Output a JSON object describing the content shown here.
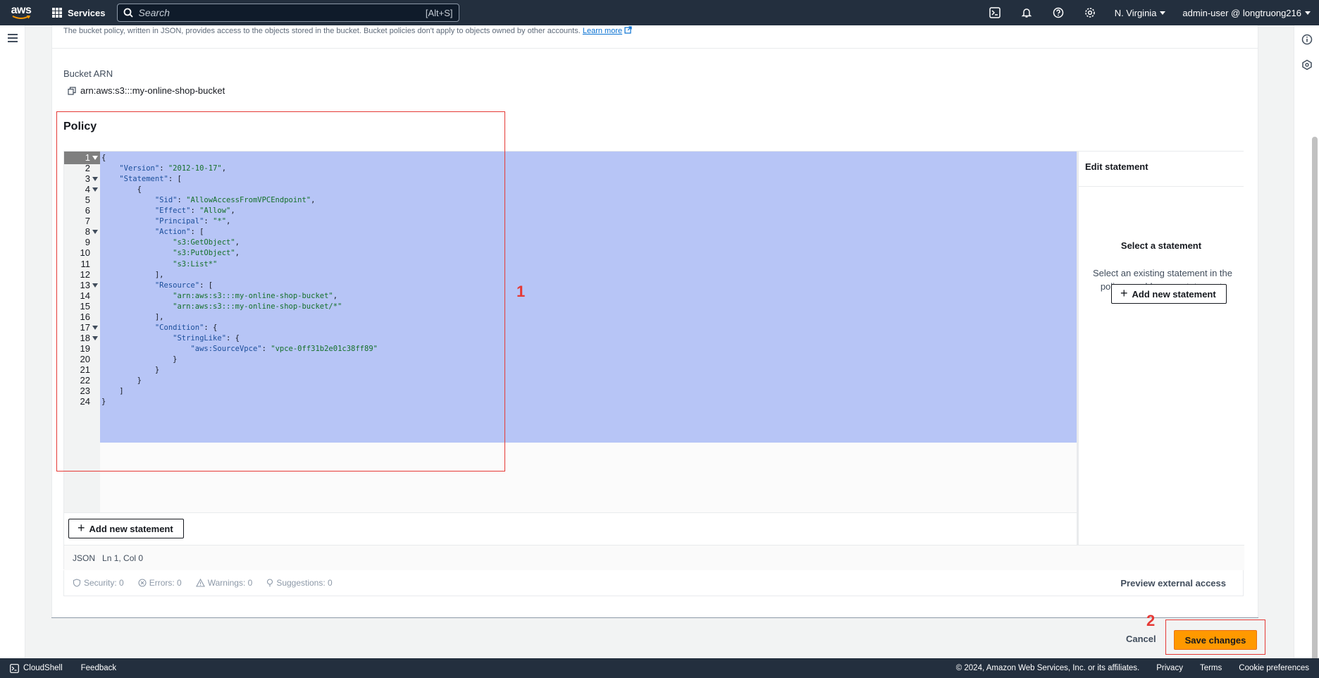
{
  "topnav": {
    "logo_text": "aws",
    "services_label": "Services",
    "search_placeholder": "Search",
    "search_shortcut": "[Alt+S]",
    "region": "N. Virginia",
    "account": "admin-user @ longtruong216"
  },
  "page": {
    "description": "The bucket policy, written in JSON, provides access to the objects stored in the bucket. Bucket policies don't apply to objects owned by other accounts.",
    "learn_more": "Learn more",
    "arn_label": "Bucket ARN",
    "arn_value": "arn:aws:s3:::my-online-shop-bucket",
    "policy_title": "Policy"
  },
  "editor": {
    "lines": [
      "{",
      "    \"Version\": \"2012-10-17\",",
      "    \"Statement\": [",
      "        {",
      "            \"Sid\": \"AllowAccessFromVPCEndpoint\",",
      "            \"Effect\": \"Allow\",",
      "            \"Principal\": \"*\",",
      "            \"Action\": [",
      "                \"s3:GetObject\",",
      "                \"s3:PutObject\",",
      "                \"s3:List*\"",
      "            ],",
      "            \"Resource\": [",
      "                \"arn:aws:s3:::my-online-shop-bucket\",",
      "                \"arn:aws:s3:::my-online-shop-bucket/*\"",
      "            ],",
      "            \"Condition\": {",
      "                \"StringLike\": {",
      "                    \"aws:SourceVpce\": \"vpce-0ff31b2e01c38ff89\"",
      "                }",
      "            }",
      "        }",
      "    ]",
      "}"
    ],
    "fold_lines": [
      1,
      3,
      4,
      8,
      13,
      17,
      18
    ],
    "add_statement_label": "Add new statement",
    "status_mode": "JSON",
    "status_position": "Ln 1, Col 0"
  },
  "statement_panel": {
    "header": "Edit statement",
    "title": "Select a statement",
    "description": "Select an existing statement in the policy or add a new statement.",
    "add_button": "Add new statement"
  },
  "validation": {
    "security": "Security: 0",
    "errors": "Errors: 0",
    "warnings": "Warnings: 0",
    "suggestions": "Suggestions: 0",
    "preview": "Preview external access"
  },
  "actions": {
    "cancel": "Cancel",
    "save": "Save changes"
  },
  "annotations": {
    "label_1": "1",
    "label_2": "2",
    "color": "#e53935"
  },
  "footer": {
    "cloudshell": "CloudShell",
    "feedback": "Feedback",
    "copyright": "© 2024, Amazon Web Services, Inc. or its affiliates.",
    "privacy": "Privacy",
    "terms": "Terms",
    "cookies": "Cookie preferences"
  },
  "colors": {
    "nav_bg": "#232f3e",
    "accent": "#ff9900",
    "selection": "#b7c5f6",
    "link": "#0972d3"
  }
}
